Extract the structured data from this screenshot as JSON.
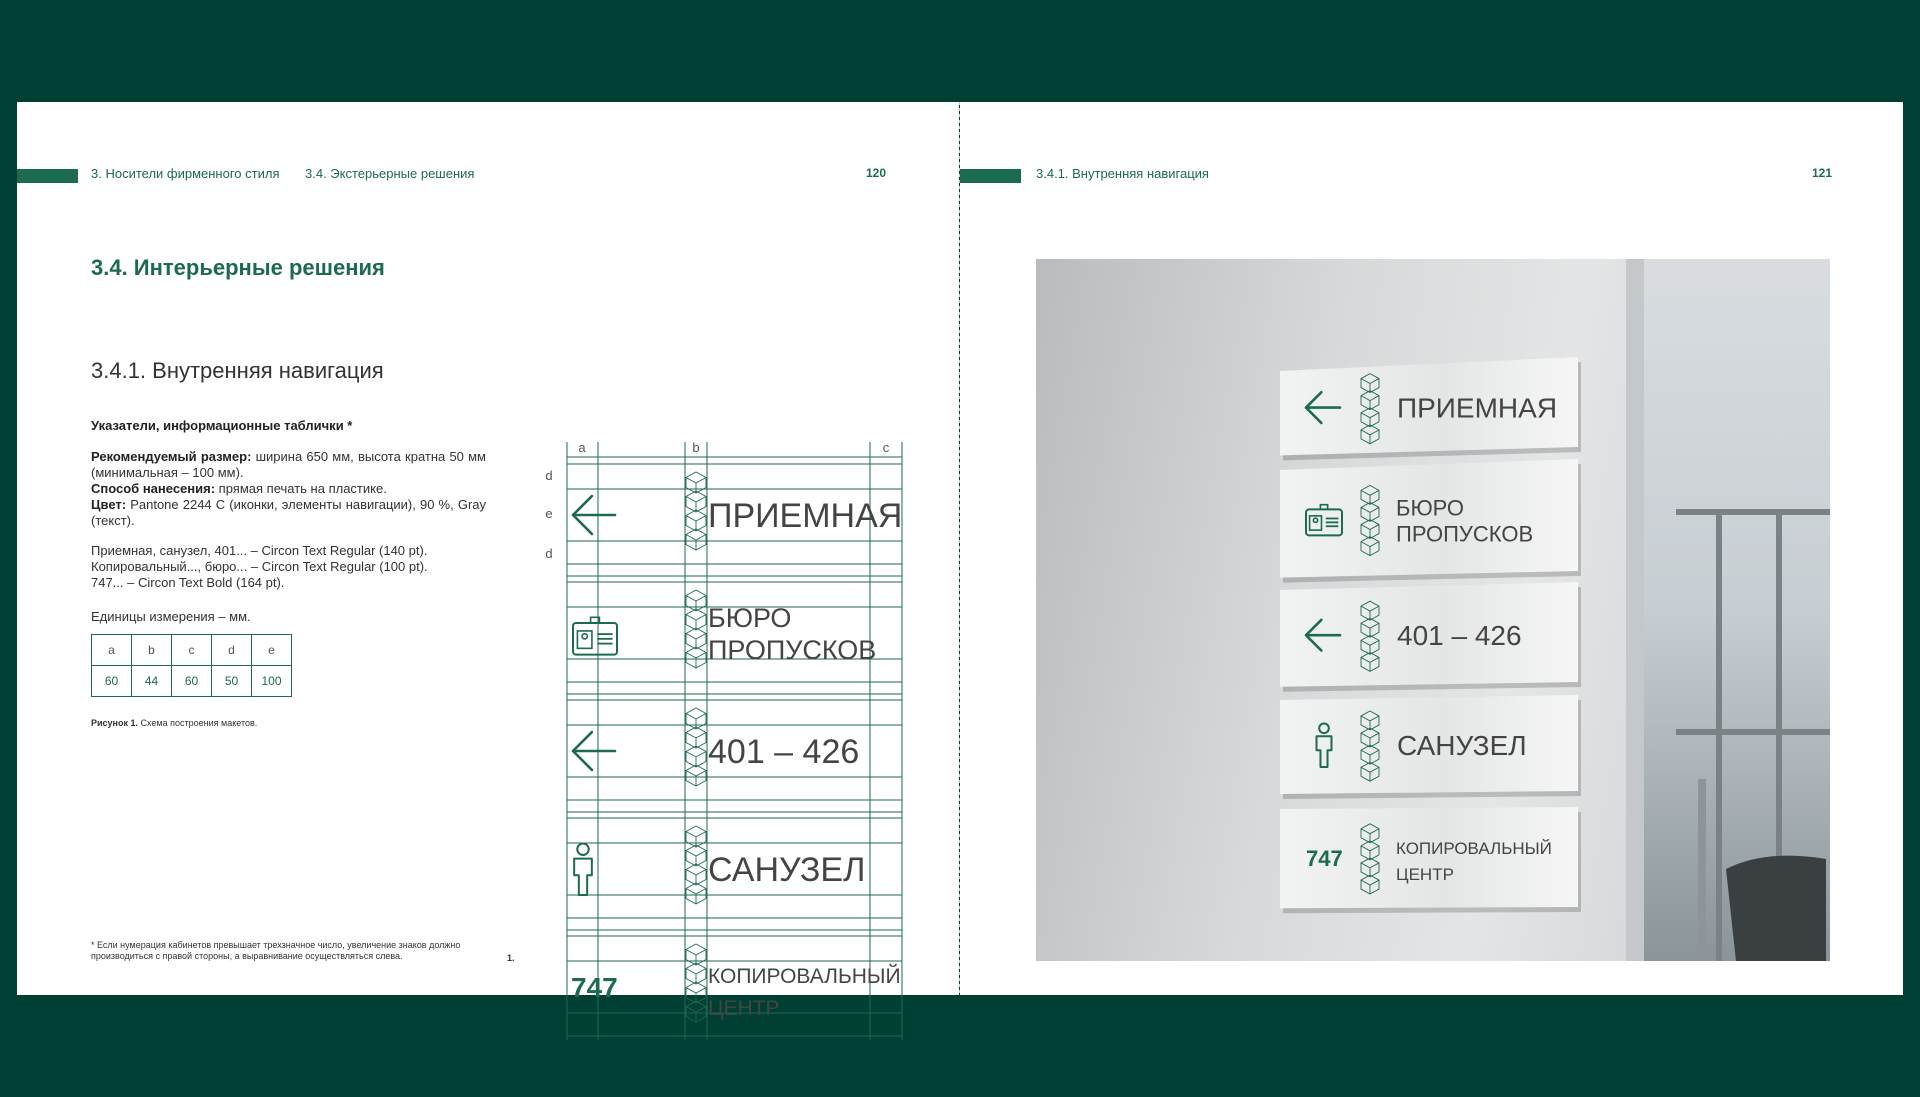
{
  "left": {
    "breadcrumb_1": "3. Носители фирменного стиля",
    "breadcrumb_2": "3.4. Экстерьерные решения",
    "page_number": "120",
    "title": "3.4. Интерьерные решения",
    "subtitle": "3.4.1. Внутренняя навигация",
    "heading": "Указатели, информационные таблички *",
    "size_label": "Рекомендуемый размер:",
    "size_text": "ширина 650 мм, высота кратна 50 мм (минимальная – 100 мм).",
    "method_label": "Способ нанесения:",
    "method_text": "прямая печать на пластике.",
    "color_label": "Цвет:",
    "color_text": "Pantone 2244 C (иконки, элементы навигации), 90 %, Gray (текст).",
    "font_line_1": "Приемная, санузел, 401... – Circon Text Regular (140 pt).",
    "font_line_2": "Копировальный..., бюро... – Circon Text Regular (100 pt).",
    "font_line_3": "747... – Circon Text Bold (164 pt).",
    "units": "Единицы измерения – мм.",
    "table": {
      "headers": [
        "a",
        "b",
        "c",
        "d",
        "e"
      ],
      "values": [
        "60",
        "44",
        "60",
        "50",
        "100"
      ]
    },
    "caption_bold": "Рисунок 1.",
    "caption_text": "Схема построения макетов.",
    "footnote": "* Если нумерация кабинетов превышает трехзначное число, увеличение знаков должно производиться с правой стороны, а выравнивание осуществляться слева.",
    "figure_number": "1."
  },
  "diagram": {
    "col_labels": [
      "a",
      "b",
      "c"
    ],
    "row_labels": [
      "d",
      "e",
      "d"
    ],
    "signs": [
      {
        "icon": "arrow-left",
        "lines": [
          "ПРИЕМНАЯ"
        ]
      },
      {
        "icon": "badge",
        "lines": [
          "БЮРО",
          "ПРОПУСКОВ"
        ]
      },
      {
        "icon": "arrow-left",
        "lines": [
          "401 – 426"
        ]
      },
      {
        "icon": "person",
        "lines": [
          "САНУЗЕЛ"
        ]
      },
      {
        "icon": "number",
        "number": "747",
        "lines": [
          "КОПИРОВАЛЬНЫЙ",
          "ЦЕНТР"
        ]
      }
    ]
  },
  "right": {
    "breadcrumb": "3.4.1. Внутренняя навигация",
    "page_number": "121"
  },
  "colors": {
    "background": "#003f33",
    "accent": "#1c6a50",
    "text": "#333333"
  }
}
